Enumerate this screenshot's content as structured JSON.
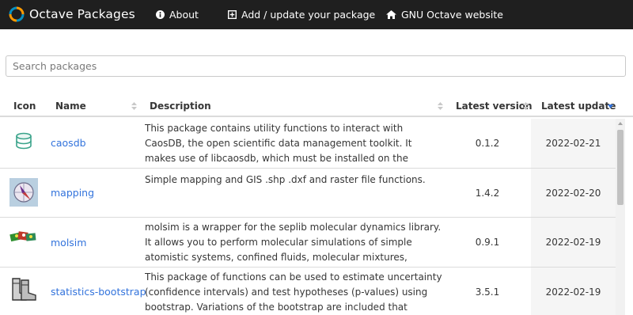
{
  "navbar": {
    "brand": "Octave Packages",
    "about": "About",
    "add": "Add / update your package",
    "website": "GNU Octave website"
  },
  "search": {
    "placeholder": "Search packages",
    "value": ""
  },
  "table": {
    "headers": {
      "icon": "Icon",
      "name": "Name",
      "description": "Description",
      "version": "Latest version",
      "update": "Latest update"
    },
    "sorted_by": "update",
    "rows": [
      {
        "icon": "database-stack-icon",
        "name": "caosdb",
        "description": "This package contains utility functions to interact with CaosDB, the open scientific data management toolkit. It makes use of libcaosdb, which must be installed on the system. libcaosdb can be obtained at",
        "version": "0.1.2",
        "update": "2022-02-21"
      },
      {
        "icon": "map-compass-icon",
        "name": "mapping",
        "description": "Simple mapping and GIS .shp .dxf and raster file functions.",
        "version": "1.4.2",
        "update": "2022-02-20"
      },
      {
        "icon": "molecule-icon",
        "name": "molsim",
        "description": "molsim is a wrapper for the seplib molecular dynamics library. It allows you to perform molecular simulations of simple atomistic systems, confined fluids, molecular mixtures, polymers and more.",
        "version": "0.9.1",
        "update": "2022-02-19"
      },
      {
        "icon": "boots-icon",
        "name": "statistics-bootstrap",
        "description": "This package of functions can be used to estimate uncertainty (confidence intervals) and test hypotheses (p-values) using bootstrap. Variations of the bootstrap are included that improve the accuracy of",
        "version": "3.5.1",
        "update": "2022-02-19"
      }
    ]
  },
  "colors": {
    "navbar": "#1f1f1f",
    "link": "#3273dc",
    "sort_active": "#3273dc",
    "logo_orange": "#ff9a00",
    "logo_blue": "#0790c0"
  }
}
